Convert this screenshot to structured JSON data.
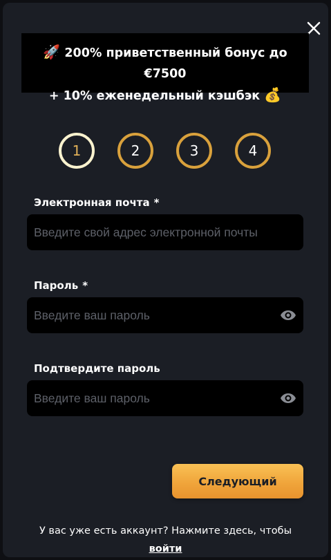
{
  "modal": {
    "close_icon": "close-icon"
  },
  "banner": {
    "line1_emoji": "🚀",
    "line1_text": "200% приветственный бонус до €7500",
    "line2_text": "+ 10% еженедельный кэшбэк",
    "line2_emoji": "💰"
  },
  "steps": [
    {
      "label": "1",
      "active": true
    },
    {
      "label": "2",
      "active": false
    },
    {
      "label": "3",
      "active": false
    },
    {
      "label": "4",
      "active": false
    }
  ],
  "form": {
    "email": {
      "label": "Электронная почта",
      "required_mark": "*",
      "placeholder": "Введите свой адрес электронной почты",
      "value": ""
    },
    "password": {
      "label": "Пароль",
      "required_mark": "*",
      "placeholder": "Введите ваш пароль",
      "value": "",
      "icon": "eye-icon"
    },
    "confirm_password": {
      "label": "Подтвердите пароль",
      "placeholder": "Введите ваш пароль",
      "value": "",
      "icon": "eye-icon"
    },
    "next_label": "Следующий"
  },
  "footer": {
    "text": "У вас уже есть аккаунт? Нажмите здесь, чтобы",
    "login_link": "войти"
  },
  "colors": {
    "background": "#0e0f13",
    "panel": "#1b1e25",
    "input_bg": "#000000",
    "accent": "#d9a13c",
    "active_step_ring": "#fbf3cf",
    "active_step_text": "#e2b158",
    "button_gradient_top": "#f9c155",
    "button_gradient_bottom": "#e8932e",
    "placeholder": "#5d6068"
  }
}
